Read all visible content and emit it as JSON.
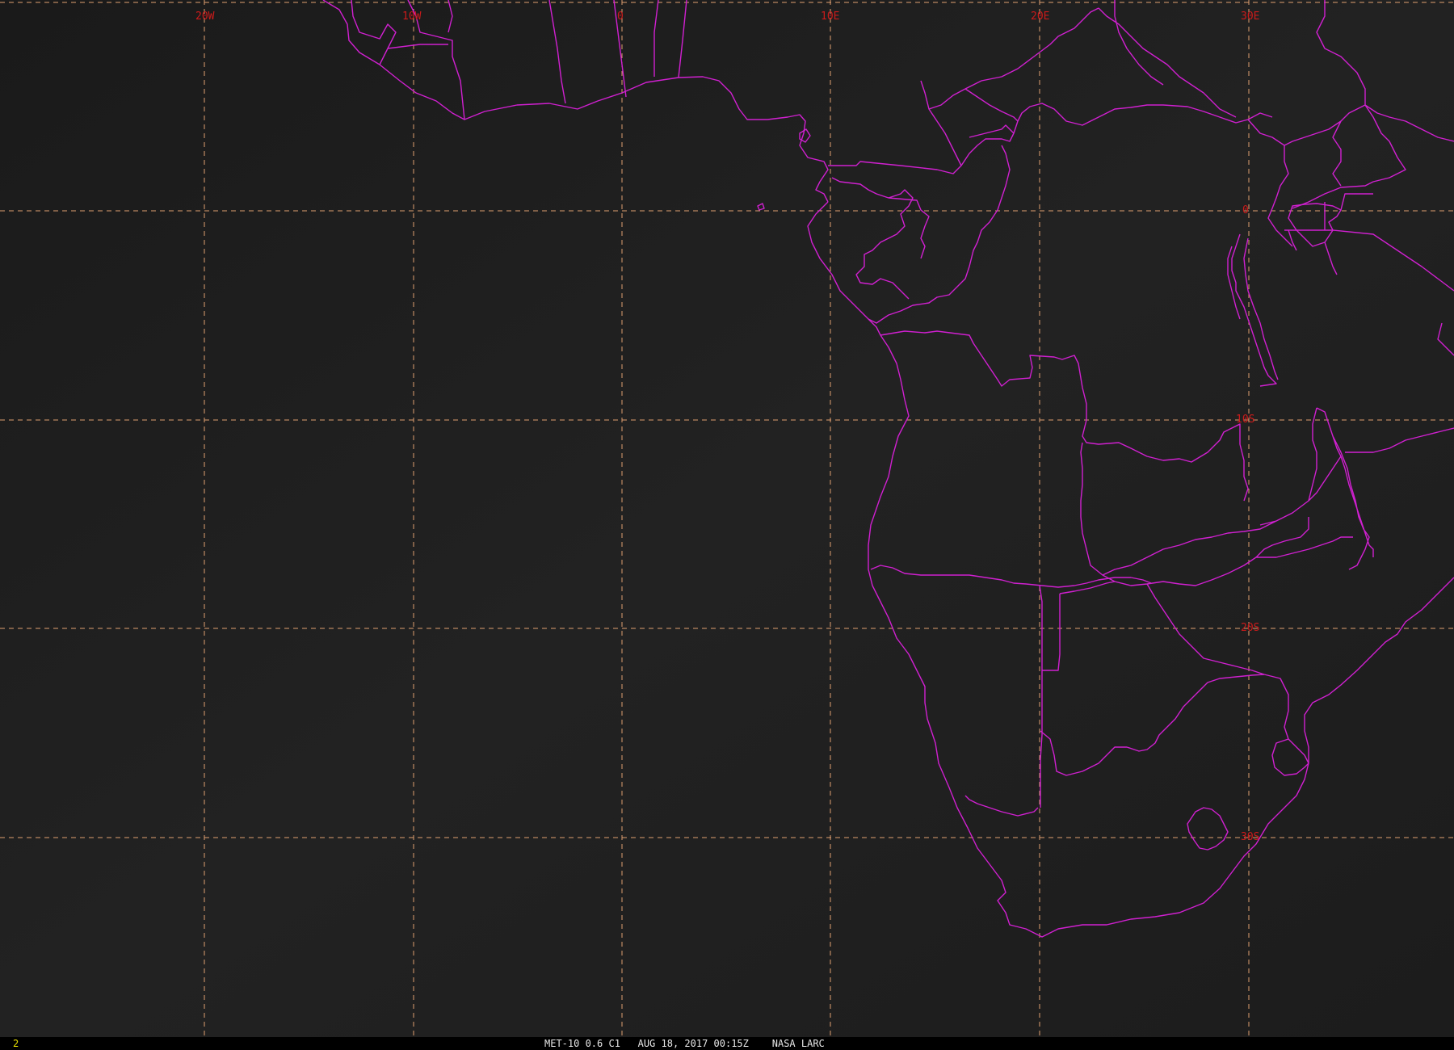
{
  "map": {
    "longitude_labels": [
      "20W",
      "10W",
      "0",
      "10E",
      "20E",
      "30E"
    ],
    "latitude_labels": [
      "0",
      "10S",
      "20S",
      "30S"
    ],
    "colors": {
      "background": "#1b1b1b",
      "grid": "#e0a070",
      "borders": "#d020d0",
      "grid_labels": "#cc1b1b"
    }
  },
  "status_bar": {
    "frame_number": "2",
    "caption": "MET-10 0.6 C1   AUG 18, 2017 00:15Z    NASA LARC"
  }
}
